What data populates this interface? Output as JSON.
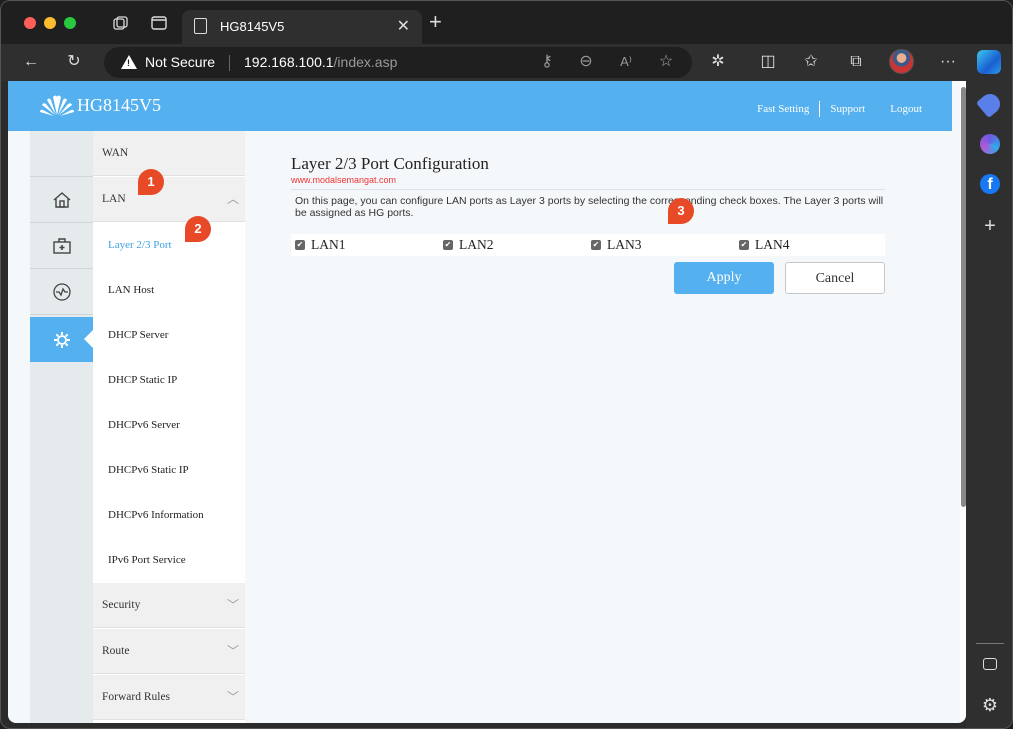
{
  "browser": {
    "tab_title": "HG8145V5",
    "security_label": "Not Secure",
    "url_host": "192.168.100.1",
    "url_path": "/index.asp"
  },
  "router": {
    "model": "HG8145V5",
    "header_links": {
      "fast_setting": "Fast Setting",
      "support": "Support",
      "logout": "Logout"
    },
    "menu": {
      "wan": "WAN",
      "lan": "LAN",
      "lan_items": [
        "Layer 2/3 Port",
        "LAN Host",
        "DHCP Server",
        "DHCP Static IP",
        "DHCPv6 Server",
        "DHCPv6 Static IP",
        "DHCPv6 Information",
        "IPv6 Port Service"
      ],
      "security": "Security",
      "route": "Route",
      "forward_rules": "Forward Rules"
    },
    "page": {
      "title": "Layer 2/3 Port Configuration",
      "watermark": "www.modalsemangat.com",
      "description": "On this page, you can configure LAN ports as Layer 3 ports by selecting the corresponding check boxes. The Layer 3 ports will be assigned as HG ports.",
      "ports": [
        {
          "label": "LAN1",
          "checked": true
        },
        {
          "label": "LAN2",
          "checked": true
        },
        {
          "label": "LAN3",
          "checked": true
        },
        {
          "label": "LAN4",
          "checked": true
        }
      ],
      "apply_label": "Apply",
      "cancel_label": "Cancel"
    }
  },
  "callouts": [
    "1",
    "2",
    "3"
  ],
  "colors": {
    "header_blue": "#54b0ef",
    "active_link": "#3ea0e0",
    "callout_red": "#e84a27",
    "watermark_red": "#ee3333"
  }
}
